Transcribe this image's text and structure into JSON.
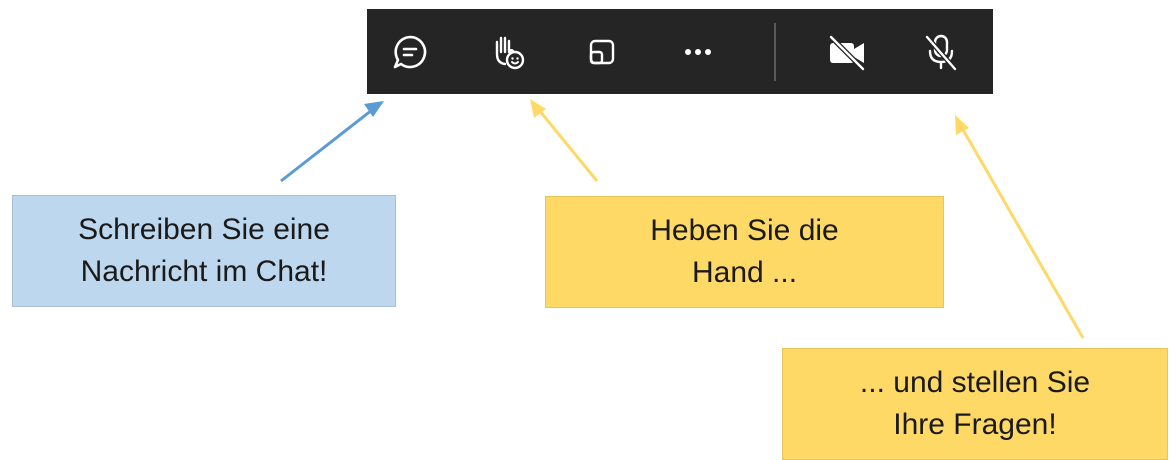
{
  "toolbar": {
    "buttons": [
      {
        "name": "chat",
        "icon": "chat-bubble-icon"
      },
      {
        "name": "raise-hand",
        "icon": "raise-hand-icon"
      },
      {
        "name": "share",
        "icon": "share-screen-icon"
      },
      {
        "name": "more",
        "icon": "more-icon"
      },
      {
        "name": "camera",
        "icon": "camera-off-icon"
      },
      {
        "name": "microphone",
        "icon": "mic-off-icon"
      }
    ]
  },
  "callouts": {
    "chat": {
      "line1": "Schreiben Sie eine",
      "line2": "Nachricht im Chat!"
    },
    "hand": {
      "line1": "Heben Sie die",
      "line2": "Hand ..."
    },
    "ask": {
      "line1": "... und stellen Sie",
      "line2": "Ihre Fragen!"
    }
  },
  "colors": {
    "toolbar_bg": "#252525",
    "icon": "#ffffff",
    "blue_callout": "#bdd7ee",
    "yellow_callout": "#ffd966",
    "blue_arrow": "#5b9bd5",
    "yellow_arrow": "#ffd966"
  }
}
